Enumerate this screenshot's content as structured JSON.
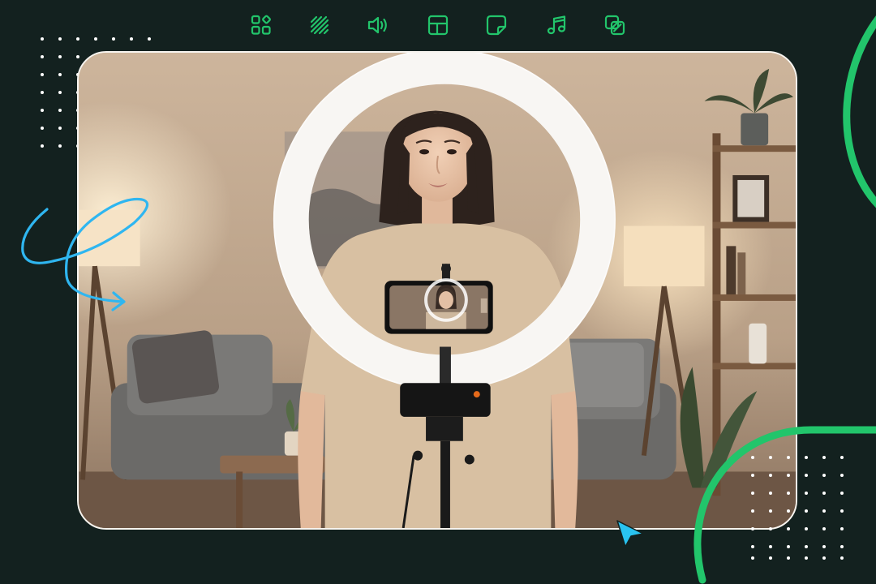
{
  "toolbar": {
    "items": [
      {
        "icon": "widgets-icon"
      },
      {
        "icon": "texture-lines-icon"
      },
      {
        "icon": "volume-icon"
      },
      {
        "icon": "layout-icon"
      },
      {
        "icon": "sticker-icon"
      },
      {
        "icon": "music-note-icon"
      },
      {
        "icon": "overlay-icon"
      }
    ]
  },
  "colors": {
    "background": "#13211f",
    "accent_green": "#22c56b",
    "accent_blue": "#2fb6f0",
    "frame_border": "#f7f4ef"
  },
  "preview": {
    "subject": "woman-with-ring-light-photo"
  }
}
